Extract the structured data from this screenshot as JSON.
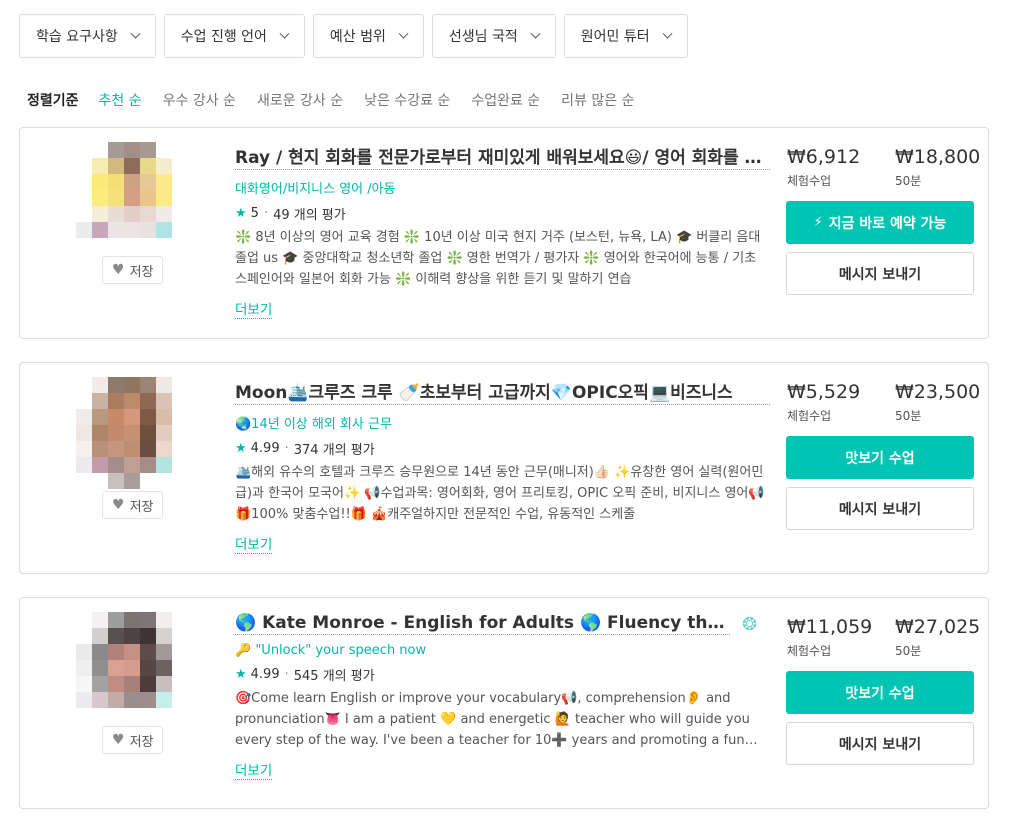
{
  "filters": [
    {
      "label": "학습 요구사항"
    },
    {
      "label": "수업 진행 언어"
    },
    {
      "label": "예산 범위"
    },
    {
      "label": "선생님 국적"
    },
    {
      "label": "원어민 튜터"
    }
  ],
  "sort": {
    "label": "정렬기준",
    "options": [
      "추천 순",
      "우수 강사 순",
      "새로운 강사 순",
      "낮은 수강료 순",
      "수업완료 순",
      "리뷰 많은 순"
    ],
    "active": "추천 순"
  },
  "tutors": [
    {
      "name": "Ray / 현지 회화를 전문가로부터 재미있게 배워보세요😃/ 영어 회화를 더 자연스럽게",
      "tagline": "대화영어/비지니스 영어 /아동",
      "rating": "5",
      "reviews": "49 개의 평가",
      "description": "❇️ 8년 이상의 영어 교육 경험 ❇️ 10년 이상 미국 현지 거주 (보스턴, 뉴욕, LA) 🎓 버클리 음대 졸업 us 🎓 중앙대학교 청소년학 졸업 ❇️ 영한 번역가 / 평가자 ❇️ 영어와 한국어에 능통 / 기초 스페인어와 일본어 회화 가능 ❇️ 이해력 향상을 위한 듣기 및 말하기 연습",
      "more": "더보기",
      "save": "저장",
      "trial_price": "₩6,912",
      "trial_label": "체험수업",
      "full_price": "₩18,800",
      "full_label": "50분",
      "primary_button": "지금 바로 예약 가능",
      "primary_icon": "lightning-icon",
      "secondary_button": "메시지 보내기",
      "avatar_colors": [
        "#ffffff",
        "#ffffff",
        "#a79a94",
        "#a29088",
        "#a69a90",
        "#ffffff",
        "#ffffff",
        "#ffffff",
        "#f6ecb0",
        "#d2b97c",
        "#8f6b5c",
        "#e8d88a",
        "#f4eecc",
        "#ffffff",
        "#ffffff",
        "#fbe97a",
        "#f3df73",
        "#cfa184",
        "#e6c796",
        "#fbe98a",
        "#ffffff",
        "#ffffff",
        "#fcec7e",
        "#f3e27a",
        "#d69f85",
        "#e9c58c",
        "#fbeb86",
        "#ffffff",
        "#ffffff",
        "#f4eed4",
        "#e9dcd3",
        "#e2cec6",
        "#e8d8d2",
        "#f1ebe8",
        "#ffffff",
        "#ececec",
        "#c7a7b9",
        "#ebe4e6",
        "#ece4e2",
        "#e6e2df",
        "#aee4e4",
        "#ffffff",
        "#ffffff",
        "#ffffff",
        "#ffffff",
        "#ffffff",
        "#ffffff",
        "#ffffff",
        "#ffffff"
      ]
    },
    {
      "name": "Moon🛳️크루즈 크루 🍼초보부터 고급까지💎OPIC오픽💻비즈니스",
      "tagline": "🌏14년 이상 해외 회사 근무",
      "rating": "4.99",
      "reviews": "374 개의 평가",
      "description": "🛳️해외 유수의 호텔과 크루즈 승무원으로 14년 동안 근무(매니저)👍🏻 ✨유창한 영어 실력(원어민급)과 한국어 모국어✨ 📢수업과목: 영어회화, 영어 프리토킹, OPIC 오픽 준비, 비지니스 영어📢 🎁100% 맞춤수업!!🎁 🎪캐주얼하지만 전문적인 수업, 유동적인 스케줄",
      "more": "더보기",
      "save": "저장",
      "trial_price": "₩5,529",
      "trial_label": "체험수업",
      "full_price": "₩23,500",
      "full_label": "50분",
      "primary_button": "맛보기 수업",
      "primary_icon": "",
      "secondary_button": "메시지 보내기",
      "avatar_colors": [
        "#ffffff",
        "#f2ece8",
        "#8e7a6c",
        "#8e7560",
        "#9b8474",
        "#efe9e5",
        "#ffffff",
        "#ffffff",
        "#cab3a4",
        "#a97d5f",
        "#bd8a6c",
        "#8e6a55",
        "#d9c3b5",
        "#ffffff",
        "#f2ece8",
        "#b99880",
        "#c98a6c",
        "#d6987a",
        "#7c5a47",
        "#d7bca8",
        "#ffffff",
        "#efe7e1",
        "#ad8669",
        "#c48a6e",
        "#c99174",
        "#6e503e",
        "#e4cbbd",
        "#ffffff",
        "#f5f0ec",
        "#bb9079",
        "#c6977e",
        "#bf8f74",
        "#6a4e41",
        "#ecd7cd",
        "#ffffff",
        "#eceaec",
        "#c29cab",
        "#a38e89",
        "#c29f94",
        "#a58d87",
        "#b2e3df",
        "#ffffff",
        "#ffffff",
        "#ffffff",
        "#c7c0bd",
        "#a89d98",
        "#ffffff",
        "#ffffff",
        "#ffffff"
      ]
    },
    {
      "name": "🌎 Kate Monroe - English for Adults 🌎 Fluency through conversation",
      "tagline": "🔑 \"Unlock\" your speech now",
      "rating": "4.99",
      "reviews": "545 개의 평가",
      "description": "🎯Come learn English or improve your vocabulary📢, comprehension👂 and pronunciation👅 I am a patient 💛 and energetic 🙋 teacher who will guide you every step of the way. I've been a teacher for 10➕ years and promoting a fun and calm learning environment.",
      "more": "더보기",
      "save": "저장",
      "trial_price": "₩11,059",
      "trial_label": "체험수업",
      "full_price": "₩27,025",
      "full_label": "50분",
      "primary_button": "맛보기 수업",
      "primary_icon": "",
      "secondary_button": "메시지 보내기",
      "badge_icon": "super-tutor-badge-icon",
      "avatar_colors": [
        "#ffffff",
        "#f3f1f1",
        "#9d9f9f",
        "#7a7474",
        "#7d7577",
        "#f2eeee",
        "#ffffff",
        "#ffffff",
        "#d1cfd0",
        "#595050",
        "#4e4243",
        "#3f3434",
        "#d6d2d2",
        "#ffffff",
        "#ebeaeb",
        "#8a8a8a",
        "#b28278",
        "#c69082",
        "#5c4c4b",
        "#a19899",
        "#ffffff",
        "#efefef",
        "#908f8f",
        "#d8a192",
        "#d69c8d",
        "#574646",
        "#6d6161",
        "#ffffff",
        "#f7f6f6",
        "#a3a2a3",
        "#c08d82",
        "#a5817a",
        "#4c3c3c",
        "#c7bfbf",
        "#ffffff",
        "#ececee",
        "#d6c8cd",
        "#c1aca8",
        "#9a8e8c",
        "#9d8d8b",
        "#c6eeea",
        "#ffffff",
        "#ffffff",
        "#ffffff",
        "#ffffff",
        "#ffffff",
        "#ffffff",
        "#ffffff",
        "#ffffff"
      ]
    }
  ]
}
